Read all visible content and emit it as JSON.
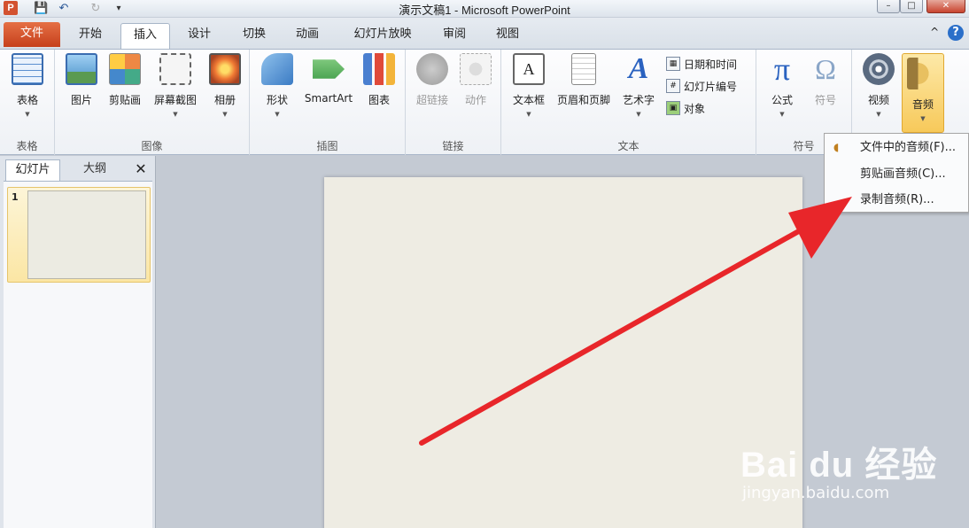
{
  "app": {
    "logo": "P",
    "window_title": "演示文稿1 - Microsoft PowerPoint"
  },
  "qat": {
    "icons": [
      "save-icon",
      "undo-icon",
      "redo-icon",
      "customize-icon"
    ]
  },
  "tabs": [
    {
      "label": "文件"
    },
    {
      "label": "开始"
    },
    {
      "label": "插入"
    },
    {
      "label": "设计"
    },
    {
      "label": "切换"
    },
    {
      "label": "动画"
    },
    {
      "label": "幻灯片放映"
    },
    {
      "label": "审阅"
    },
    {
      "label": "视图"
    }
  ],
  "help": {
    "label": "?",
    "minimize": "^"
  },
  "ribbon": {
    "groups": {
      "table": "表格",
      "images": "图像",
      "illustrations": "插图",
      "links": "链接",
      "text": "文本",
      "symbols": "符号"
    },
    "buttons": {
      "table": "表格",
      "picture": "图片",
      "clipart": "剪贴画",
      "screenshot": "屏幕截图",
      "album": "相册",
      "shapes": "形状",
      "smartart": "SmartArt",
      "chart": "图表",
      "hyperlink": "超链接",
      "action": "动作",
      "textbox": "文本框",
      "header_footer": "页眉和页脚",
      "wordart": "艺术字",
      "equation": "公式",
      "symbol": "符号",
      "video": "视频",
      "audio": "音频"
    },
    "small_buttons": {
      "datetime": "日期和时间",
      "slide_number": "幻灯片编号",
      "object": "对象"
    }
  },
  "pane": {
    "tab_slides": "幻灯片",
    "tab_outline": "大纲",
    "close": "✕",
    "slide_number": "1"
  },
  "dropdown": {
    "items": [
      "文件中的音频(F)...",
      "剪贴画音频(C)...",
      "录制音频(R)..."
    ]
  },
  "watermark": {
    "brand": "Bai du 经验",
    "url": "jingyan.baidu.com"
  },
  "colors": {
    "file_tab": "#c6401c",
    "ribbon_bg": "#eef1f5",
    "slide_bg": "#eeece3",
    "arrow": "#e8262a",
    "audio_highlight": "#f7c95a"
  }
}
